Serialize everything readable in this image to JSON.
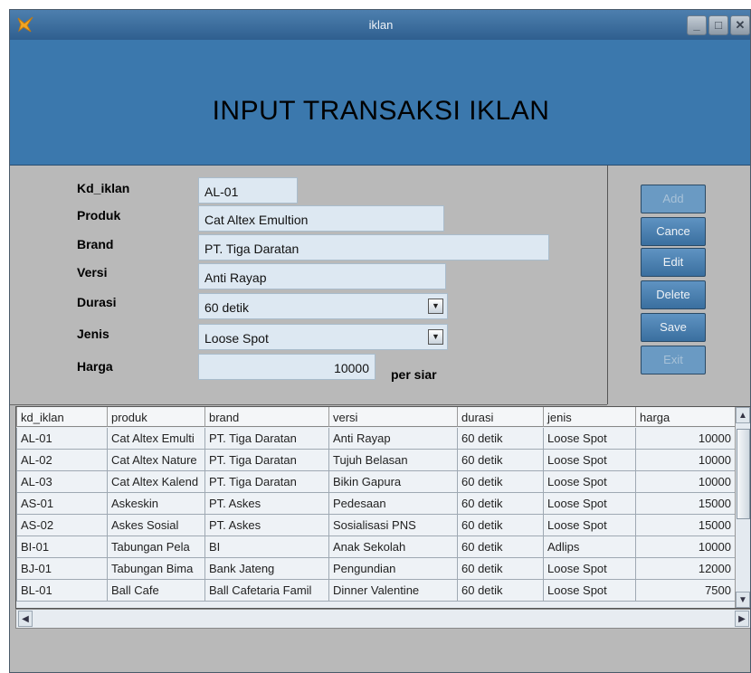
{
  "window": {
    "title": "iklan",
    "controls": [
      "minimize-icon",
      "maximize-icon",
      "close-icon"
    ]
  },
  "header": {
    "title": "INPUT TRANSAKSI IKLAN"
  },
  "form": {
    "kd_iklan": {
      "label": "Kd_iklan",
      "value": "AL-01"
    },
    "produk": {
      "label": "Produk",
      "value": "Cat Altex Emultion"
    },
    "brand": {
      "label": "Brand",
      "value": "PT. Tiga Daratan"
    },
    "versi": {
      "label": "Versi",
      "value": "Anti Rayap"
    },
    "durasi": {
      "label": "Durasi",
      "value": "60 detik"
    },
    "jenis": {
      "label": "Jenis",
      "value": "Loose Spot"
    },
    "harga": {
      "label": "Harga",
      "value": "10000",
      "suffix": "per siar"
    }
  },
  "buttons": {
    "add": "Add",
    "cancel": "Cance",
    "edit": "Edit",
    "delete": "Delete",
    "save": "Save",
    "exit": "Exit"
  },
  "table": {
    "columns": [
      "kd_iklan",
      "produk",
      "brand",
      "versi",
      "durasi",
      "jenis",
      "harga"
    ],
    "rows": [
      [
        "AL-01",
        "Cat Altex Emulti",
        "PT. Tiga Daratan",
        "Anti Rayap",
        "60 detik",
        "Loose Spot",
        "10000"
      ],
      [
        "AL-02",
        "Cat Altex Nature",
        "PT. Tiga Daratan",
        "Tujuh Belasan",
        "60 detik",
        "Loose Spot",
        "10000"
      ],
      [
        "AL-03",
        "Cat Altex Kalend",
        "PT. Tiga Daratan",
        "Bikin Gapura",
        "60 detik",
        "Loose Spot",
        "10000"
      ],
      [
        "AS-01",
        "Askeskin",
        "PT. Askes",
        "Pedesaan",
        "60 detik",
        "Loose Spot",
        "15000"
      ],
      [
        "AS-02",
        "Askes Sosial",
        "PT. Askes",
        "Sosialisasi PNS",
        "60 detik",
        "Loose Spot",
        "15000"
      ],
      [
        "BI-01",
        "Tabungan Pela",
        "BI",
        "Anak Sekolah",
        "60 detik",
        "Adlips",
        "10000"
      ],
      [
        "BJ-01",
        "Tabungan Bima",
        "Bank Jateng",
        "Pengundian",
        "60 detik",
        "Loose Spot",
        "12000"
      ],
      [
        "BL-01",
        "Ball Cafe",
        "Ball Cafetaria Famil",
        "Dinner Valentine",
        "60 detik",
        "Loose Spot",
        "7500"
      ]
    ]
  }
}
